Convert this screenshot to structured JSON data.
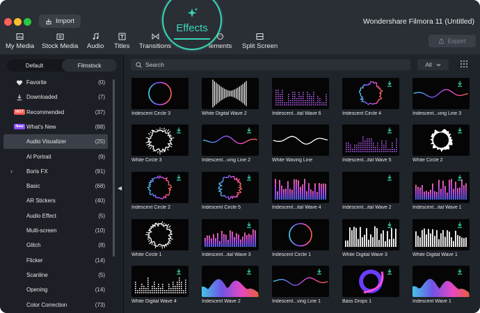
{
  "window": {
    "title": "Wondershare Filmora 11 (Untitled)"
  },
  "header": {
    "import_label": "Import",
    "export_label": "Export"
  },
  "toolbar": {
    "tabs": [
      {
        "label": "My Media",
        "icon": "media-icon"
      },
      {
        "label": "Stock Media",
        "icon": "stock-media-icon"
      },
      {
        "label": "Audio",
        "icon": "music-note-icon"
      },
      {
        "label": "Titles",
        "icon": "titles-icon"
      },
      {
        "label": "Transitions",
        "icon": "transitions-icon"
      },
      {
        "label": "Effects",
        "icon": "sparkle-icon"
      },
      {
        "label": "Elements",
        "icon": "elements-icon"
      },
      {
        "label": "Split Screen",
        "icon": "split-screen-icon"
      }
    ],
    "elements_partial": "lements"
  },
  "sidebar": {
    "segments": [
      "Default",
      "Filmstock"
    ],
    "active_segment": "Filmstock",
    "categories": [
      {
        "label": "Favorite",
        "count": "(0)",
        "icon": "heart-icon"
      },
      {
        "label": "Downloaded",
        "count": "(7)",
        "icon": "download-icon"
      },
      {
        "label": "Recommended",
        "count": "(37)",
        "badge": "HOT"
      },
      {
        "label": "What's New",
        "count": "(88)",
        "badge": "New"
      },
      {
        "label": "Audio Visualizer",
        "count": "(25)",
        "selected": true
      },
      {
        "label": "AI Portrait",
        "count": "(9)"
      },
      {
        "label": "Boris FX",
        "count": "(91)",
        "expandable": true
      },
      {
        "label": "Basic",
        "count": "(68)"
      },
      {
        "label": "AR Stickers",
        "count": "(40)"
      },
      {
        "label": "Audio Effect",
        "count": "(5)"
      },
      {
        "label": "Multi-screen",
        "count": "(10)"
      },
      {
        "label": "Glitch",
        "count": "(8)"
      },
      {
        "label": "Flicker",
        "count": "(14)"
      },
      {
        "label": "Scanline",
        "count": "(5)"
      },
      {
        "label": "Opening",
        "count": "(14)"
      },
      {
        "label": "Color Correction",
        "count": "(73)"
      }
    ]
  },
  "search": {
    "placeholder": "Search",
    "filter_value": "All"
  },
  "effects": [
    {
      "label": "Iridescent Circle 3",
      "style": "burst-iri",
      "download": false
    },
    {
      "label": "White  Digital Wave 2",
      "style": "hourglass-white",
      "download": false
    },
    {
      "label": "Iridescent...ital Wave 6",
      "style": "dots-iri",
      "download": false
    },
    {
      "label": "Iridescent Circle 4",
      "style": "circle-iri",
      "download": true
    },
    {
      "label": "Iridescent...ving Line 3",
      "style": "line-iri",
      "download": true
    },
    {
      "label": "White Circle 3",
      "style": "circle-white",
      "download": true
    },
    {
      "label": "Iridescent...ving Line 2",
      "style": "line-iri",
      "download": true
    },
    {
      "label": "White Waving Line",
      "style": "line-white",
      "download": false
    },
    {
      "label": "Iridescent...ital Wave 5",
      "style": "dots-iri",
      "download": true
    },
    {
      "label": "White Circle 2",
      "style": "disc-white",
      "download": true
    },
    {
      "label": "Iridescent Circle 2",
      "style": "circle-iri",
      "download": true
    },
    {
      "label": "Iridescent Circle 5",
      "style": "circle-iri",
      "download": true
    },
    {
      "label": "Iridescent...ital Wave 4",
      "style": "bars-iri",
      "download": false
    },
    {
      "label": "Iridescent...ital Wave 2",
      "style": "hourglass-iri",
      "download": true
    },
    {
      "label": "Iridescent...ital Wave 1",
      "style": "bars-iri",
      "download": true
    },
    {
      "label": "White Circle 1",
      "style": "circle-white",
      "download": false
    },
    {
      "label": "Iridescent...ital Wave 3",
      "style": "bars-iri",
      "download": true
    },
    {
      "label": "Iridescent Circle 1",
      "style": "burst-iri",
      "download": false
    },
    {
      "label": "White Digital Wave 3",
      "style": "bars-white",
      "download": true
    },
    {
      "label": "White Digital Wave 1",
      "style": "bars-white",
      "download": true
    },
    {
      "label": "White  Digital Wave 4",
      "style": "dots-white",
      "download": true
    },
    {
      "label": "Iridescent Wave 2",
      "style": "area-iri",
      "download": true
    },
    {
      "label": "Iridescent...ving Line 1",
      "style": "line-iri",
      "download": true
    },
    {
      "label": "Bass Drops 1",
      "style": "bass-drops",
      "download": true
    },
    {
      "label": "Iridescent Wave 1",
      "style": "area-iri",
      "download": true
    }
  ],
  "colors": {
    "accent": "#3cd6b8",
    "download": "#35d6ad",
    "hot": "#ff5a4e",
    "new": "#8a4dff"
  }
}
